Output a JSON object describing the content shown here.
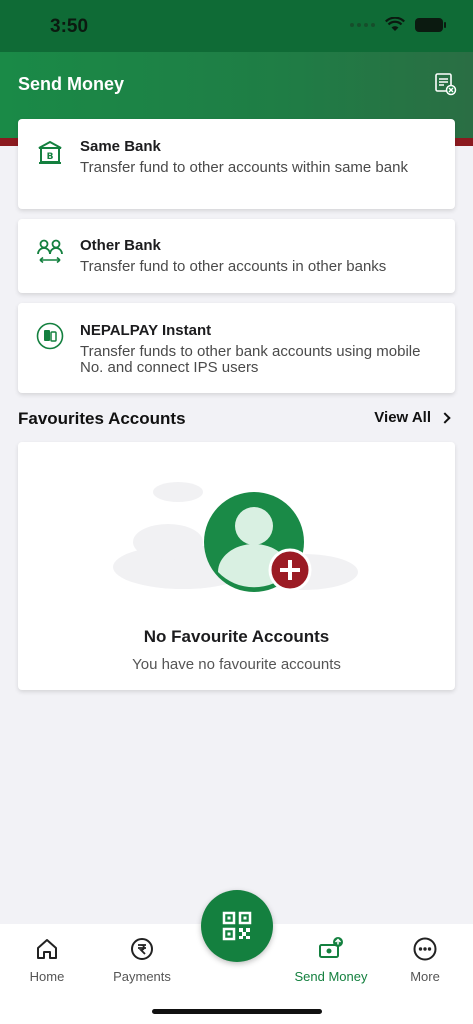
{
  "status_bar": {
    "time": "3:50"
  },
  "header": {
    "title": "Send Money",
    "right_icon": "transaction-history-icon"
  },
  "options": [
    {
      "title": "Same Bank",
      "description": "Transfer fund to other accounts within same bank",
      "icon": "bank-icon"
    },
    {
      "title": "Other Bank",
      "description": "Transfer fund to other accounts in other banks",
      "icon": "people-transfer-icon"
    },
    {
      "title": "NEPALPAY Instant",
      "description": "Transfer funds to other bank accounts using mobile No. and connect IPS users",
      "icon": "phone-transfer-icon"
    }
  ],
  "favourites": {
    "title": "Favourites Accounts",
    "view_all": "View All",
    "empty_title": "No Favourite Accounts",
    "empty_desc": "You have no favourite accounts"
  },
  "bottom_nav": {
    "items": [
      {
        "label": "Home",
        "icon": "home-icon"
      },
      {
        "label": "Payments",
        "icon": "payments-icon"
      },
      {
        "label": "Send Money",
        "icon": "send-money-icon",
        "active": true
      },
      {
        "label": "More",
        "icon": "more-icon"
      }
    ],
    "fab_icon": "qr-code-icon"
  },
  "colors": {
    "primary": "#14803f",
    "accent_red": "#8b1a1f"
  }
}
